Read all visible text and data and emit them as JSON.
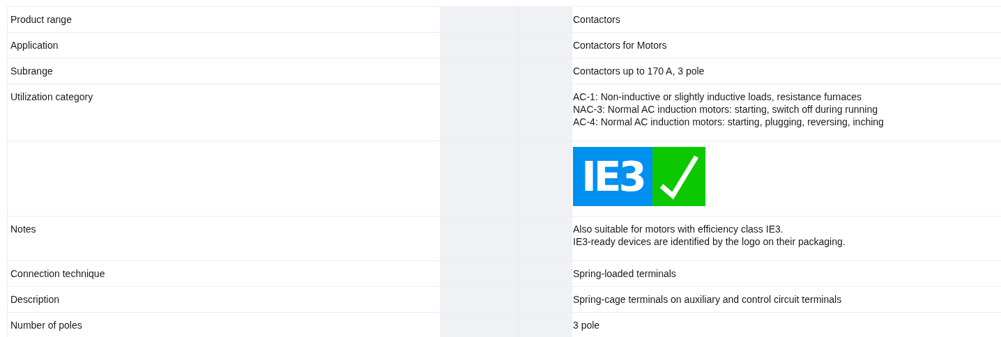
{
  "rows": [
    {
      "kind": "text",
      "label": "Product range",
      "lines": [
        "Contactors"
      ]
    },
    {
      "kind": "text",
      "label": "Application",
      "lines": [
        "Contactors for Motors"
      ]
    },
    {
      "kind": "text",
      "label": "Subrange",
      "lines": [
        "Contactors up to 170 A, 3 pole"
      ]
    },
    {
      "kind": "text",
      "label": "Utilization category",
      "lines": [
        "AC-1: Non-inductive or slightly inductive loads, resistance furnaces",
        "NAC-3: Normal AC induction motors: starting, switch off during running",
        "AC-4: Normal AC induction motors: starting, plugging, reversing, inching"
      ]
    },
    {
      "kind": "logo",
      "logo_text": "IE3"
    },
    {
      "kind": "text",
      "label": "Notes",
      "lines": [
        "Also suitable for motors with efficiency class IE3.",
        "IE3-ready devices are identified by the logo on their packaging."
      ]
    },
    {
      "kind": "text",
      "label": "Connection technique",
      "lines": [
        "Spring-loaded terminals"
      ]
    },
    {
      "kind": "text",
      "label": "Description",
      "lines": [
        "Spring-cage terminals on auxiliary and control circuit terminals"
      ]
    },
    {
      "kind": "text",
      "label": "Number of poles",
      "lines": [
        "3 pole"
      ]
    }
  ]
}
